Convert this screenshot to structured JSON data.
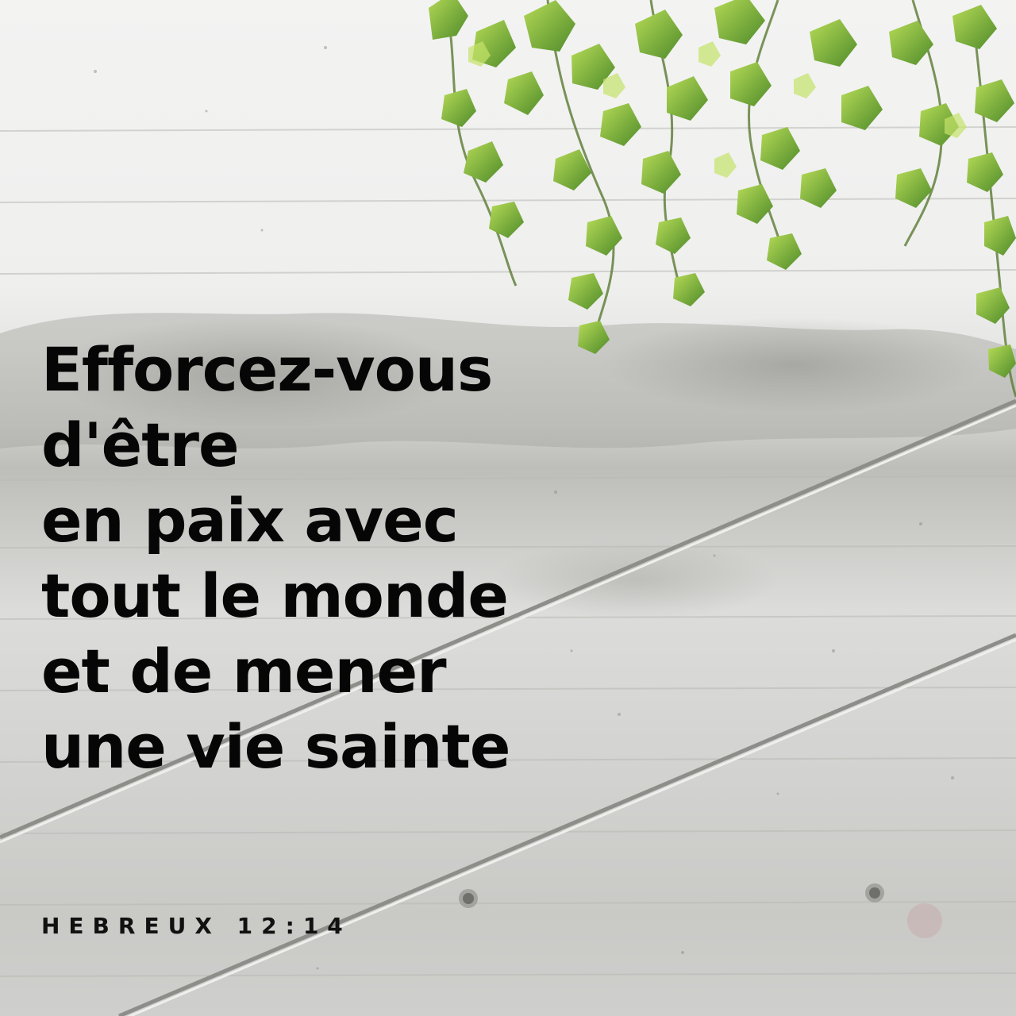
{
  "verse": {
    "lines": [
      "Efforcez-vous",
      "d'être",
      "en paix avec",
      "tout le monde",
      "et de mener",
      "une vie sainte"
    ],
    "reference": "HEBREUX 12:14"
  },
  "colors": {
    "text": "#060606",
    "wall_light": "#efefee",
    "wall_mid": "#cfcfcc",
    "wall_stain": "#a9a9a4",
    "leaf_dark": "#4f8f2a",
    "leaf_light": "#a9d44a"
  }
}
